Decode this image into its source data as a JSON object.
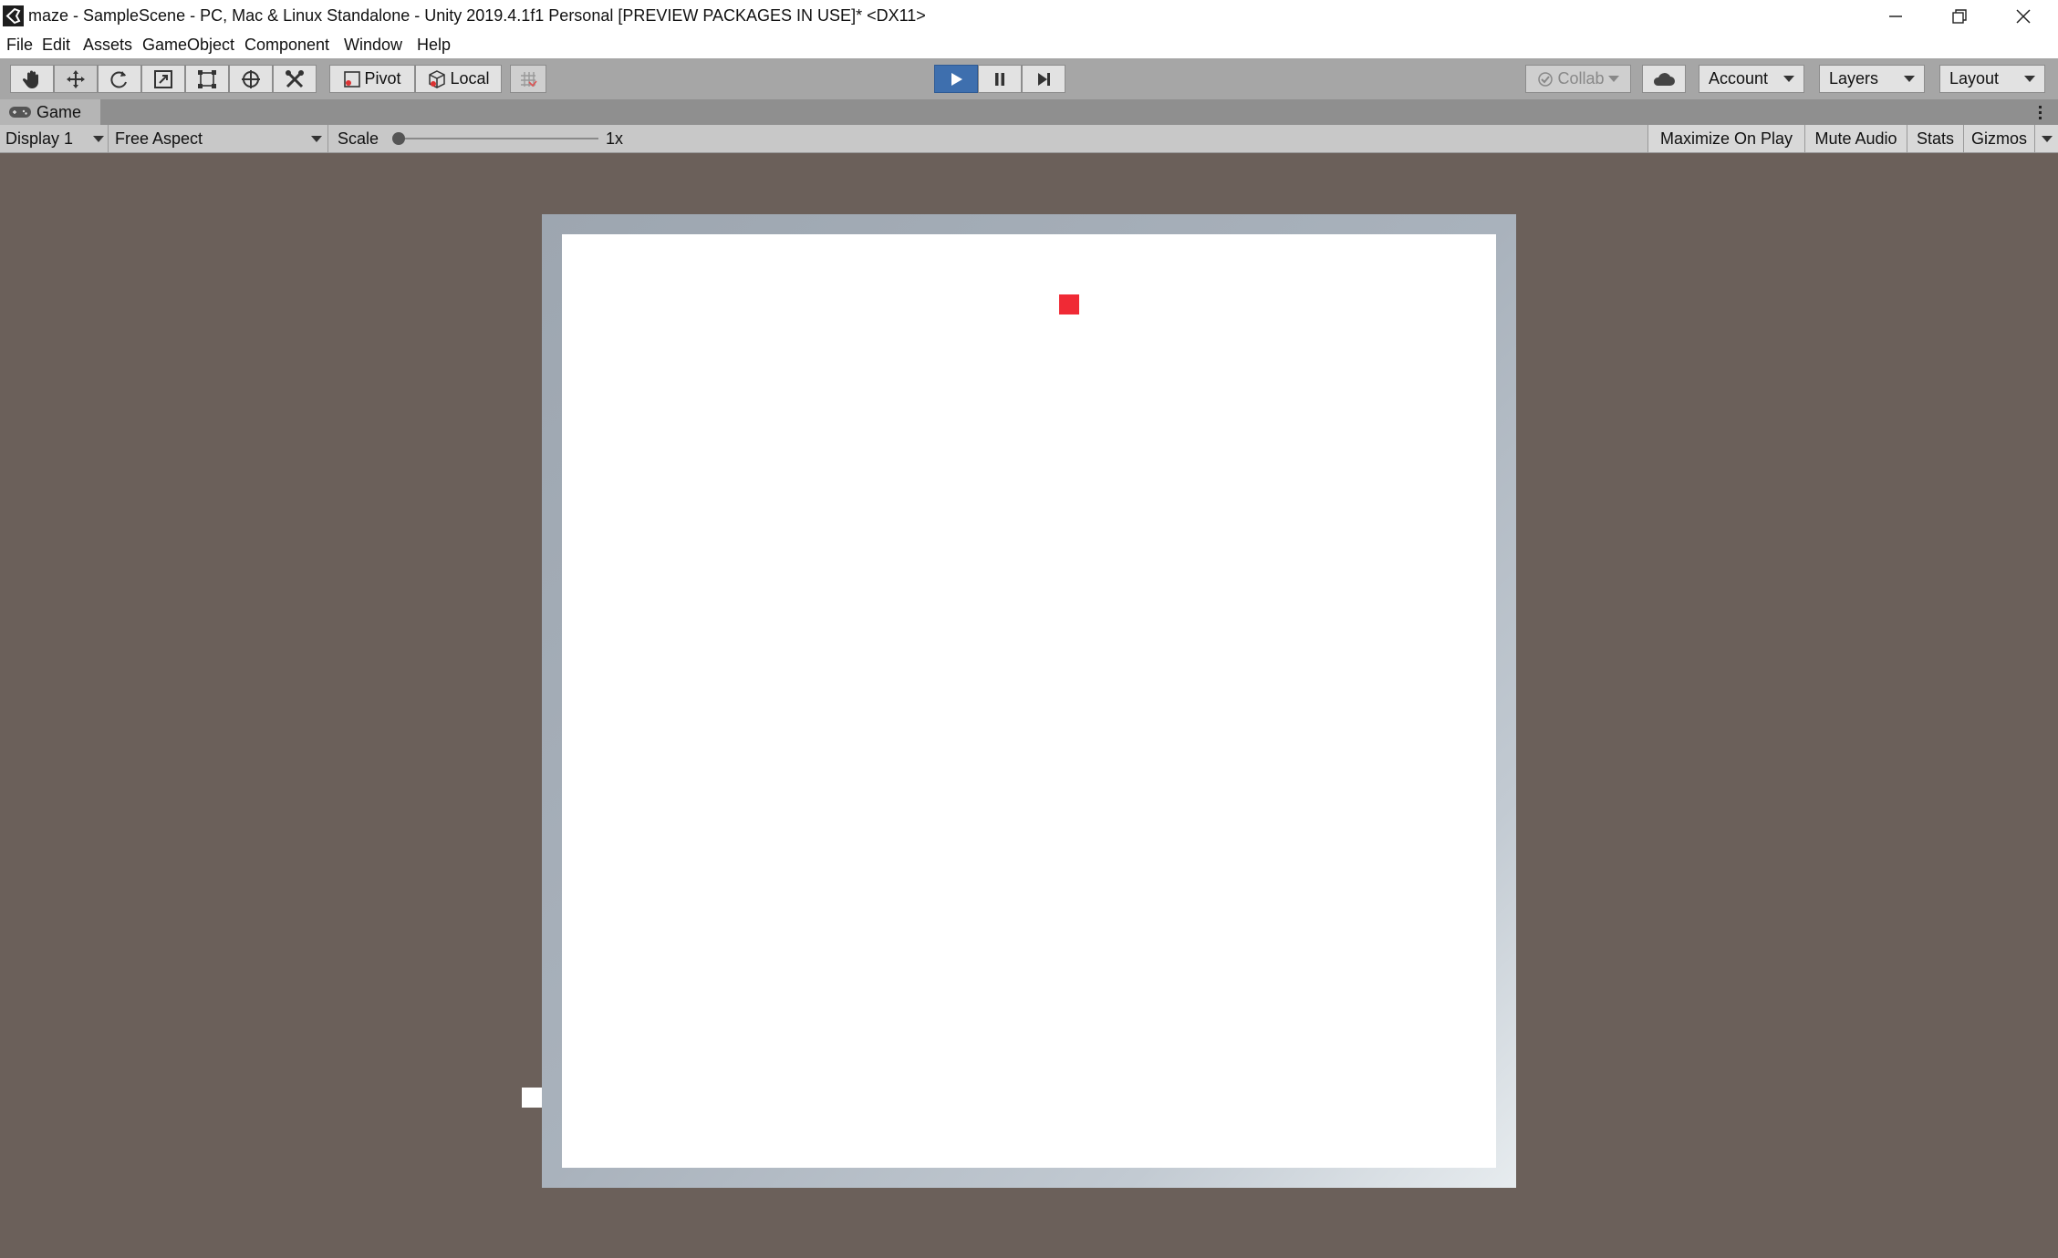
{
  "window": {
    "title": "maze - SampleScene - PC, Mac & Linux Standalone - Unity 2019.4.1f1 Personal [PREVIEW PACKAGES IN USE]* <DX11>"
  },
  "menu": [
    "File",
    "Edit",
    "Assets",
    "GameObject",
    "Component",
    "Window",
    "Help"
  ],
  "toolbar": {
    "tools": [
      "hand-tool-icon",
      "move-tool-icon",
      "rotate-tool-icon",
      "scale-tool-icon",
      "rect-tool-icon",
      "transform-tool-icon",
      "custom-tool-icon"
    ],
    "pivot_label": "Pivot",
    "local_label": "Local",
    "collab_label": "Collab",
    "account_label": "Account",
    "layers_label": "Layers",
    "layout_label": "Layout"
  },
  "tab": {
    "label": "Game"
  },
  "gamebar": {
    "display": "Display 1",
    "aspect": "Free Aspect",
    "scale_label": "Scale",
    "scale_value": "1x",
    "maximize": "Maximize On Play",
    "mute": "Mute Audio",
    "stats": "Stats",
    "gizmos": "Gizmos"
  },
  "colors": {
    "play_active": "#3e6fae",
    "goal": "#f02a35",
    "background": "#6b605a"
  }
}
